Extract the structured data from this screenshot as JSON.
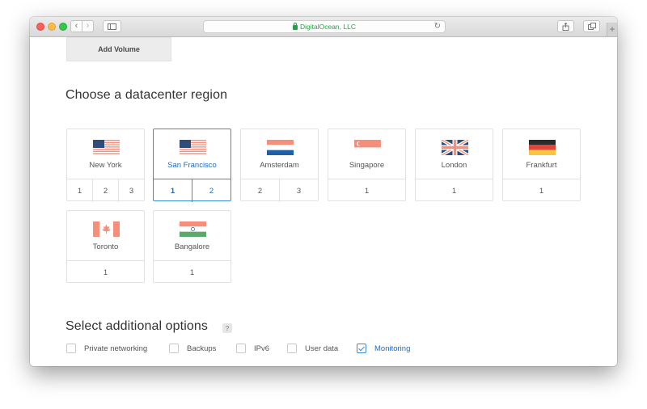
{
  "browser": {
    "address": "DigitalOcean, LLC",
    "back_icon": "chevron-left-icon",
    "forward_icon": "chevron-right-icon"
  },
  "volume": {
    "add_label": "Add Volume"
  },
  "datacenter": {
    "title": "Choose a datacenter region",
    "regions": [
      {
        "name": "New York",
        "flag": "us-flag-icon",
        "numbers": [
          "1",
          "2",
          "3"
        ],
        "selected": false
      },
      {
        "name": "San Francisco",
        "flag": "us-flag-icon",
        "numbers": [
          "1",
          "2"
        ],
        "selected": true,
        "active_number": "1"
      },
      {
        "name": "Amsterdam",
        "flag": "nl-flag-icon",
        "numbers": [
          "2",
          "3"
        ],
        "selected": false
      },
      {
        "name": "Singapore",
        "flag": "sg-flag-icon",
        "numbers": [
          "1"
        ],
        "selected": false
      },
      {
        "name": "London",
        "flag": "uk-flag-icon",
        "numbers": [
          "1"
        ],
        "selected": false
      },
      {
        "name": "Frankfurt",
        "flag": "de-flag-icon",
        "numbers": [
          "1"
        ],
        "selected": false
      },
      {
        "name": "Toronto",
        "flag": "ca-flag-icon",
        "numbers": [
          "1"
        ],
        "selected": false
      },
      {
        "name": "Bangalore",
        "flag": "in-flag-icon",
        "numbers": [
          "1"
        ],
        "selected": false
      }
    ]
  },
  "options": {
    "title": "Select additional options",
    "help": "?",
    "items": [
      {
        "label": "Private networking",
        "checked": false
      },
      {
        "label": "Backups",
        "checked": false
      },
      {
        "label": "IPv6",
        "checked": false
      },
      {
        "label": "User data",
        "checked": false
      },
      {
        "label": "Monitoring",
        "checked": true
      }
    ]
  },
  "colors": {
    "accent": "#1b6ac9",
    "flag_red": "#f58e7a",
    "flag_blue": "#1f5fa8",
    "flag_navy": "#2e4d7a"
  }
}
